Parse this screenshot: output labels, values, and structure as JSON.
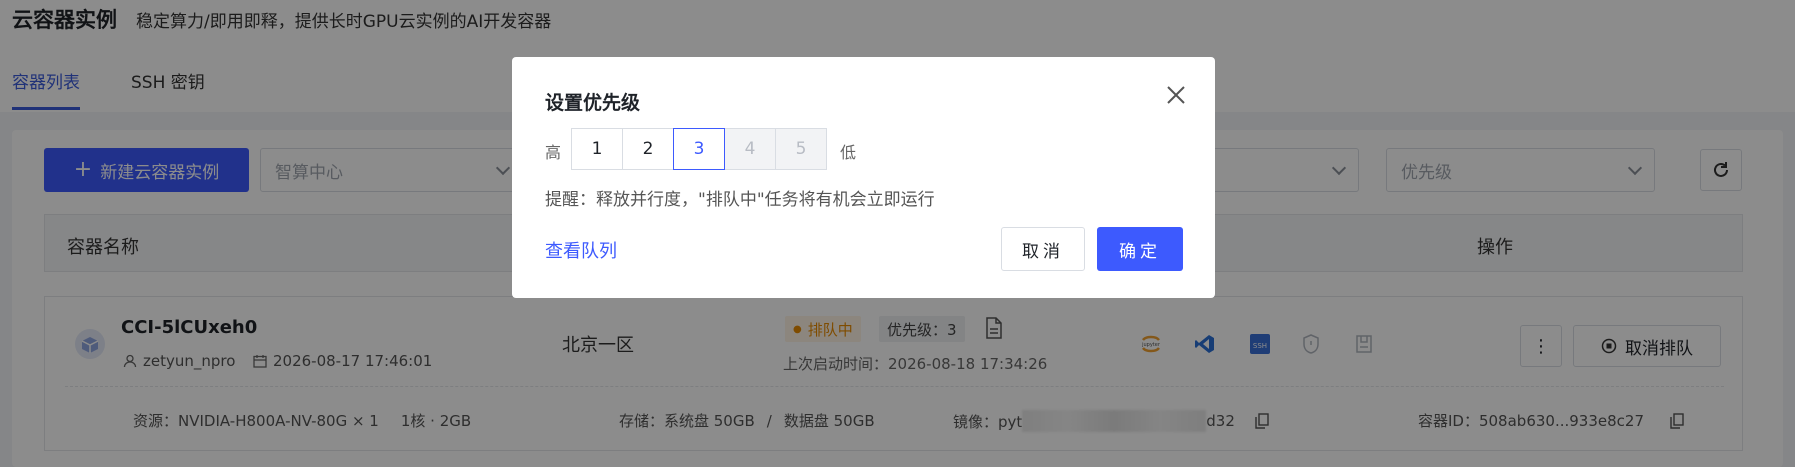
{
  "header": {
    "title": "云容器实例",
    "subtitle": "稳定算力/即用即释，提供长时GPU云实例的AI开发容器"
  },
  "tabs": [
    {
      "label": "容器列表",
      "active": true
    },
    {
      "label": "SSH 密钥",
      "active": false
    }
  ],
  "toolbar": {
    "new_button": "新建云容器实例",
    "datacenter_placeholder": "智算中心",
    "priority_placeholder": "优先级"
  },
  "table": {
    "col_name": "容器名称",
    "col_actions": "操作"
  },
  "row": {
    "name": "CCI-5lCUxeh0",
    "user": "zetyun_npro",
    "created": "2026-08-17 17:46:01",
    "region": "北京一区",
    "status": "排队中",
    "priority_label": "优先级：3",
    "last_start": "上次启动时间：2026-08-18 17:34:26",
    "cancel_queue": "取消排队",
    "resource": "资源：NVIDIA-H800A-NV-80G × 1",
    "cpu_mem": "1核 · 2GB",
    "storage_sys": "存储：系统盘 50GB",
    "storage_sep": "/",
    "storage_data": "数据盘 50GB",
    "image_prefix": "镜像：pyt",
    "image_suffix": "d32",
    "container_id": "容器ID：508ab630...933e8c27"
  },
  "modal": {
    "title": "设置优先级",
    "high": "高",
    "low": "低",
    "levels": [
      "1",
      "2",
      "3",
      "4",
      "5"
    ],
    "selected": 3,
    "tip": "提醒：释放并行度，\"排队中\"任务将有机会立即运行",
    "view_queue": "查看队列",
    "cancel": "取消",
    "confirm": "确定"
  },
  "colors": {
    "primary": "#3d5afe",
    "queue": "#e88a00"
  }
}
